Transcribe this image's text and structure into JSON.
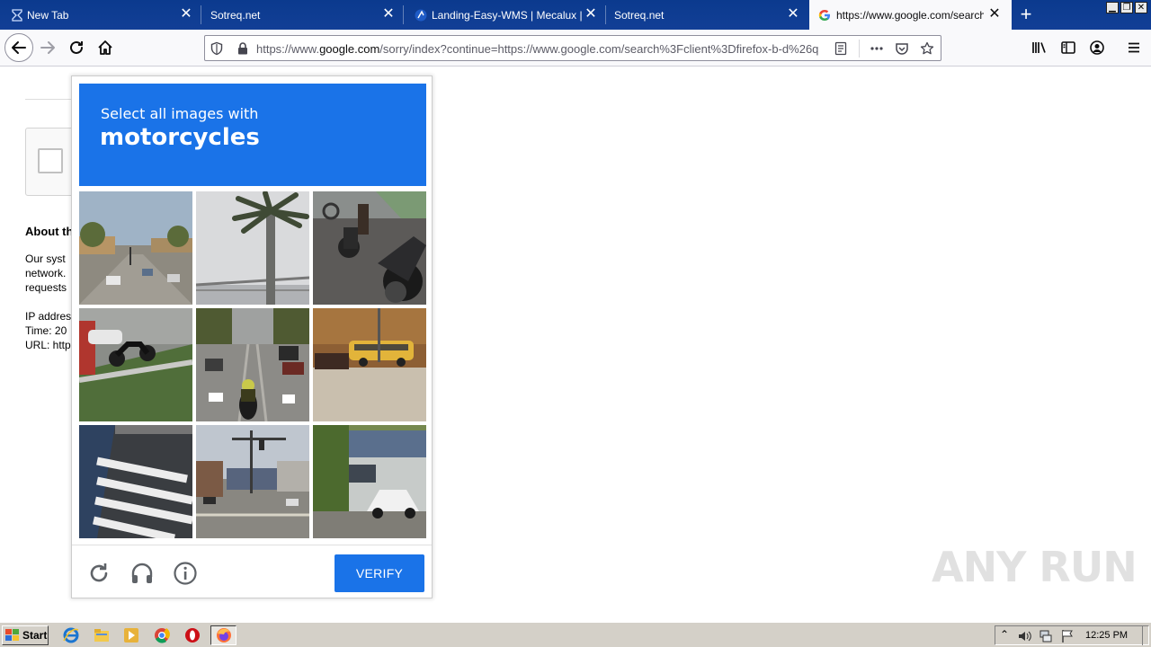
{
  "browser": {
    "tabs": [
      {
        "title": "New Tab",
        "active": false
      },
      {
        "title": "Sotreq.net",
        "active": false
      },
      {
        "title": "Landing-Easy-WMS | Mecalux | www",
        "active": false
      },
      {
        "title": "Sotreq.net",
        "active": false
      },
      {
        "title": "https://www.google.com/search?c",
        "active": true
      }
    ],
    "new_tab_symbol": "+",
    "close_symbol": "✕",
    "url": {
      "prefix": "https://www.",
      "host": "google.com",
      "rest": "/sorry/index?continue=https://www.google.com/search%3Fclient%3Dfirefox-b-d%26q"
    },
    "icons": [
      "back-arrow-icon",
      "forward-arrow-icon",
      "reload-icon",
      "home-icon",
      "shield-icon",
      "lock-icon",
      "reader-view-icon",
      "more-actions-icon",
      "pocket-icon",
      "bookmark-star-icon",
      "library-icon",
      "sidebar-icon",
      "account-icon",
      "menu-icon"
    ]
  },
  "page": {
    "about_heading": "About th",
    "para_lines": [
      "Our syst",
      "network.",
      "requests"
    ],
    "info_lines": [
      "IP addres",
      "Time: 20",
      "URL: http"
    ]
  },
  "captcha": {
    "intro": "Select all images with",
    "target": "motorcycles",
    "verify_label": "VERIFY",
    "accent": "#1a73e8",
    "tiles": [
      "street-intersection",
      "palm-tree-bridge",
      "parked-motorcycles",
      "motorcycle-roadside",
      "motorcycle-traffic",
      "school-bus",
      "crosswalk",
      "street-traffic-light",
      "house-car"
    ],
    "footer_icons": [
      "reload-icon",
      "audio-headphones-icon",
      "info-icon"
    ]
  },
  "watermark": "ANY RUN",
  "taskbar": {
    "start_label": "Start",
    "apps": [
      "internet-explorer-icon",
      "file-explorer-icon",
      "media-player-icon",
      "chrome-icon",
      "opera-icon",
      "firefox-icon"
    ],
    "clock": "12:25 PM"
  }
}
